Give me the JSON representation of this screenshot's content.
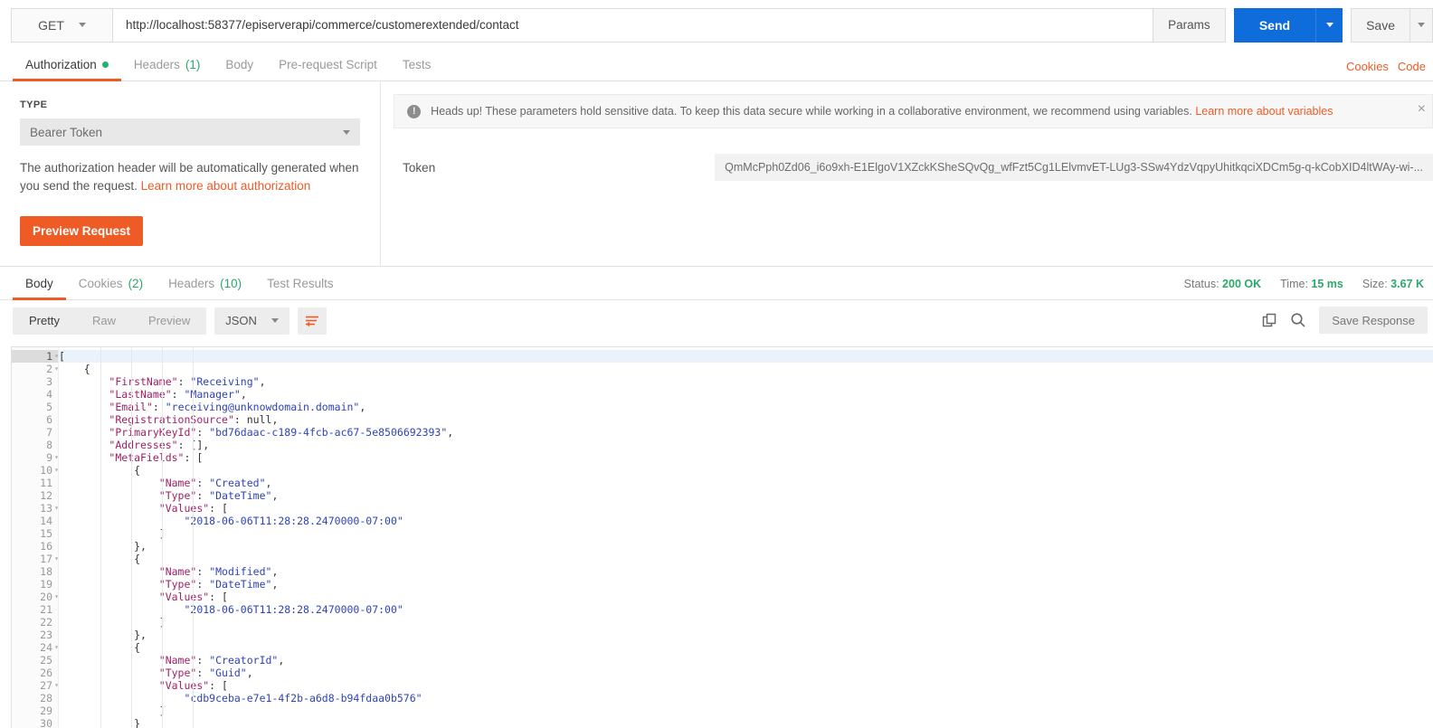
{
  "request": {
    "method": "GET",
    "url": "http://localhost:58377/episerverapi/commerce/customerextended/contact",
    "params_label": "Params",
    "send_label": "Send",
    "save_label": "Save"
  },
  "request_tabs": [
    {
      "label": "Authorization",
      "count": "",
      "active": true,
      "dot": true
    },
    {
      "label": "Headers",
      "count": "(1)",
      "active": false,
      "dot": false
    },
    {
      "label": "Body",
      "count": "",
      "active": false,
      "dot": false
    },
    {
      "label": "Pre-request Script",
      "count": "",
      "active": false,
      "dot": false
    },
    {
      "label": "Tests",
      "count": "",
      "active": false,
      "dot": false
    }
  ],
  "tab_links": [
    {
      "label": "Cookies"
    },
    {
      "label": "Code"
    }
  ],
  "auth": {
    "type_label": "TYPE",
    "type_value": "Bearer Token",
    "description_before": "The authorization header will be automatically generated when you send the request. ",
    "description_link": "Learn more about authorization",
    "preview_button": "Preview Request",
    "token_label": "Token",
    "token_value": "QmMcPph0Zd06_i6o9xh-E1ElgoV1XZckKSheSQvQg_wfFzt5Cg1LElvmvET-LUg3-SSw4YdzVqpyUhitkqciXDCm5g-q-kCobXID4ltWAy-wi-..."
  },
  "notice": {
    "icon": "exclamation-circle-icon",
    "text": "Heads up! These parameters hold sensitive data. To keep this data secure while working in a collaborative environment, we recommend using variables. ",
    "link": "Learn more about variables",
    "close": "×"
  },
  "response_tabs": [
    {
      "label": "Body",
      "count": "",
      "active": true
    },
    {
      "label": "Cookies",
      "count": "(2)",
      "active": false
    },
    {
      "label": "Headers",
      "count": "(10)",
      "active": false
    },
    {
      "label": "Test Results",
      "count": "",
      "active": false
    }
  ],
  "response_meta": [
    {
      "label": "Status:",
      "value": "200 OK"
    },
    {
      "label": "Time:",
      "value": "15 ms"
    },
    {
      "label": "Size:",
      "value": "3.67 K"
    }
  ],
  "response_toolbar": {
    "views": [
      {
        "label": "Pretty",
        "active": true
      },
      {
        "label": "Raw",
        "active": false
      },
      {
        "label": "Preview",
        "active": false
      }
    ],
    "format": "JSON",
    "wrap_icon": "word-wrap-icon",
    "copy_icon": "copy-icon",
    "search_icon": "search-icon",
    "save_response": "Save Response"
  },
  "code": {
    "language": "json",
    "lines": [
      {
        "n": 1,
        "fold": true,
        "active": true,
        "text": "["
      },
      {
        "n": 2,
        "fold": true,
        "active": false,
        "text": "    {"
      },
      {
        "n": 3,
        "fold": false,
        "active": false,
        "text": "        \"FirstName\": \"Receiving\","
      },
      {
        "n": 4,
        "fold": false,
        "active": false,
        "text": "        \"LastName\": \"Manager\","
      },
      {
        "n": 5,
        "fold": false,
        "active": false,
        "text": "        \"Email\": \"receiving@unknowdomain.domain\","
      },
      {
        "n": 6,
        "fold": false,
        "active": false,
        "text": "        \"RegistrationSource\": null,"
      },
      {
        "n": 7,
        "fold": false,
        "active": false,
        "text": "        \"PrimaryKeyId\": \"bd76daac-c189-4fcb-ac67-5e8506692393\","
      },
      {
        "n": 8,
        "fold": false,
        "active": false,
        "text": "        \"Addresses\": [],"
      },
      {
        "n": 9,
        "fold": true,
        "active": false,
        "text": "        \"MetaFields\": ["
      },
      {
        "n": 10,
        "fold": true,
        "active": false,
        "text": "            {"
      },
      {
        "n": 11,
        "fold": false,
        "active": false,
        "text": "                \"Name\": \"Created\","
      },
      {
        "n": 12,
        "fold": false,
        "active": false,
        "text": "                \"Type\": \"DateTime\","
      },
      {
        "n": 13,
        "fold": true,
        "active": false,
        "text": "                \"Values\": ["
      },
      {
        "n": 14,
        "fold": false,
        "active": false,
        "text": "                    \"2018-06-06T11:28:28.2470000-07:00\""
      },
      {
        "n": 15,
        "fold": false,
        "active": false,
        "text": "                ]"
      },
      {
        "n": 16,
        "fold": false,
        "active": false,
        "text": "            },"
      },
      {
        "n": 17,
        "fold": true,
        "active": false,
        "text": "            {"
      },
      {
        "n": 18,
        "fold": false,
        "active": false,
        "text": "                \"Name\": \"Modified\","
      },
      {
        "n": 19,
        "fold": false,
        "active": false,
        "text": "                \"Type\": \"DateTime\","
      },
      {
        "n": 20,
        "fold": true,
        "active": false,
        "text": "                \"Values\": ["
      },
      {
        "n": 21,
        "fold": false,
        "active": false,
        "text": "                    \"2018-06-06T11:28:28.2470000-07:00\""
      },
      {
        "n": 22,
        "fold": false,
        "active": false,
        "text": "                ]"
      },
      {
        "n": 23,
        "fold": false,
        "active": false,
        "text": "            },"
      },
      {
        "n": 24,
        "fold": true,
        "active": false,
        "text": "            {"
      },
      {
        "n": 25,
        "fold": false,
        "active": false,
        "text": "                \"Name\": \"CreatorId\","
      },
      {
        "n": 26,
        "fold": false,
        "active": false,
        "text": "                \"Type\": \"Guid\","
      },
      {
        "n": 27,
        "fold": true,
        "active": false,
        "text": "                \"Values\": ["
      },
      {
        "n": 28,
        "fold": false,
        "active": false,
        "text": "                    \"cdb9ceba-e7e1-4f2b-a6d8-b94fdaa0b576\""
      },
      {
        "n": 29,
        "fold": false,
        "active": false,
        "text": "                ]"
      },
      {
        "n": 30,
        "fold": false,
        "active": false,
        "text": "            }"
      }
    ]
  },
  "colors": {
    "accent_orange": "#ef5b25",
    "send_blue": "#0f6cdb",
    "status_green": "#2aa96a",
    "json_key": "#a11f63",
    "json_string": "#2f43b7"
  }
}
